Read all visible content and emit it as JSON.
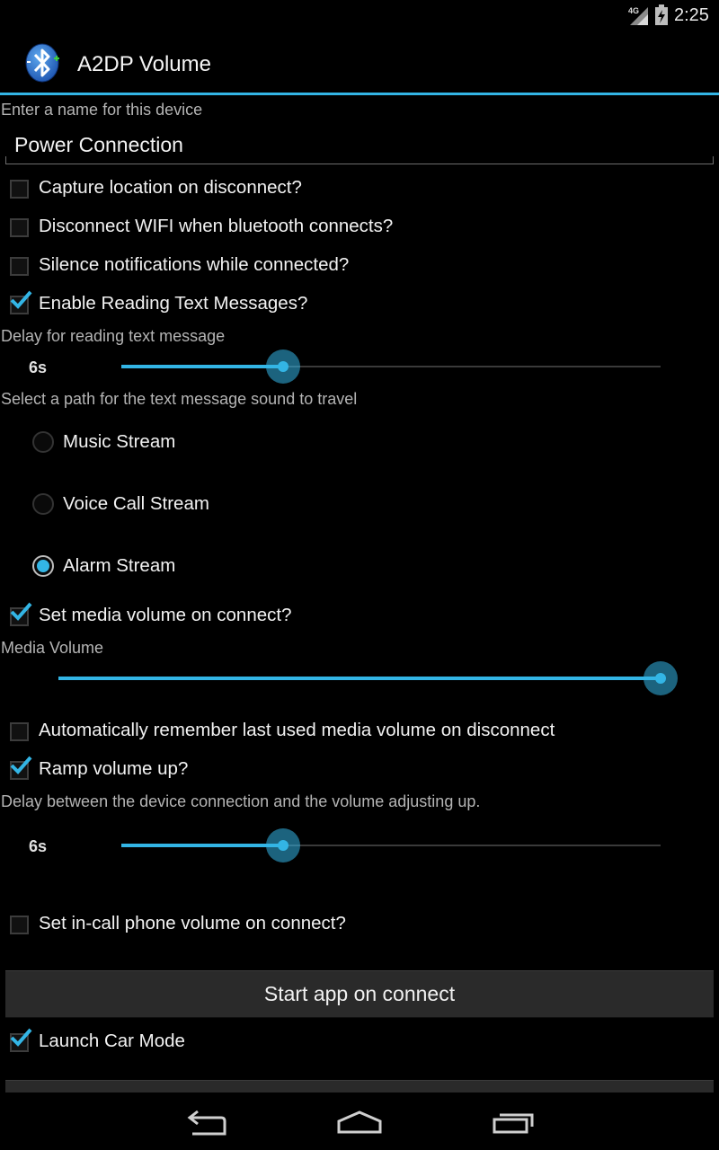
{
  "status_bar": {
    "time": "2:25",
    "network": "4G",
    "icons": [
      "signal-icon",
      "battery-charging-icon"
    ]
  },
  "app_bar": {
    "title": "A2DP Volume",
    "icon": "bluetooth-icon"
  },
  "device_name": {
    "label": "Enter a name for this device",
    "value": "Power Connection"
  },
  "options": {
    "capture_location": {
      "label": "Capture location on disconnect?",
      "checked": false
    },
    "disconnect_wifi": {
      "label": "Disconnect WIFI when bluetooth connects?",
      "checked": false
    },
    "silence_notifications": {
      "label": "Silence notifications while connected?",
      "checked": false
    },
    "read_text": {
      "label": "Enable Reading Text Messages?",
      "checked": true
    }
  },
  "read_delay": {
    "label": "Delay for reading text message",
    "value_text": "6s",
    "fraction": 0.3
  },
  "sound_path": {
    "label": "Select a path for the text message sound to travel",
    "options": [
      "Music Stream",
      "Voice Call Stream",
      "Alarm Stream"
    ],
    "selected": "Alarm Stream"
  },
  "media_volume_option": {
    "label": "Set media volume on connect?",
    "checked": true
  },
  "media_volume": {
    "label": "Media Volume",
    "fraction": 1.0
  },
  "remember_volume": {
    "label": "Automatically remember last used media volume on disconnect",
    "checked": false
  },
  "ramp_volume": {
    "label": "Ramp volume up?",
    "checked": true
  },
  "ramp_delay": {
    "label": "Delay between the device connection and the volume adjusting up.",
    "value_text": "6s",
    "fraction": 0.3
  },
  "incall_volume": {
    "label": "Set in-call phone volume on connect?",
    "checked": false
  },
  "start_app_button": "Start app on connect",
  "car_mode": {
    "label": "Launch Car Mode",
    "checked": true
  },
  "nav_bar": {
    "buttons": [
      "back-icon",
      "home-icon",
      "recents-icon"
    ]
  },
  "colors": {
    "accent": "#33b5e5",
    "background": "#000000"
  }
}
